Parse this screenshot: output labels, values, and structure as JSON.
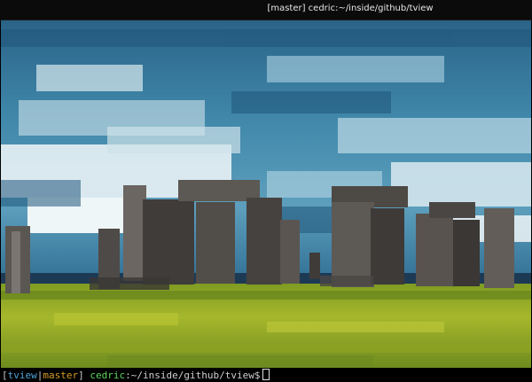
{
  "window": {
    "title": "[master] cedric:~/inside/github/tview"
  },
  "image": {
    "subject": "stonehenge-pixelated",
    "colors": {
      "sky": "#2e7196",
      "cloud": "#e7f1f4",
      "stone": "#56514d",
      "grass": "#9bb12a",
      "grass_dark": "#5c7a1b"
    }
  },
  "prompt": {
    "open_bracket": "[",
    "dir": "tview",
    "sep": "|",
    "branch": "master",
    "close_bracket": "]",
    "user": "cedric",
    "colon": ":",
    "path": "~/inside/github/tview",
    "symbol": "$"
  }
}
